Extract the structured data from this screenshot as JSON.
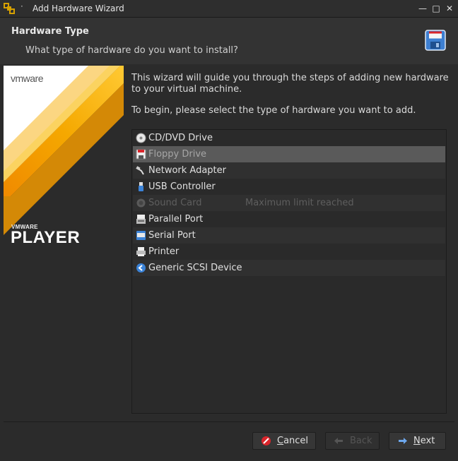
{
  "window": {
    "title": "Add Hardware Wizard",
    "menu_glyph": "·",
    "controls": {
      "minimize": "—",
      "maximize": "□",
      "close": "✕"
    }
  },
  "header": {
    "title": "Hardware Type",
    "subtitle": "What type of hardware do you want to install?",
    "icon": "floppy-disk-icon"
  },
  "banner": {
    "logo": "vmware",
    "product_small": "VMWARE",
    "product_big": "PLAYER"
  },
  "intro": {
    "line1": "This wizard will guide you through the steps of adding new hardware to your virtual machine.",
    "line2": "To begin, please select the type of hardware you want to add."
  },
  "hardware_list": [
    {
      "label": "CD/DVD Drive",
      "note": "",
      "icon": "cd-dvd-icon",
      "state": "normal"
    },
    {
      "label": "Floppy Drive",
      "note": "",
      "icon": "floppy-icon",
      "state": "selected"
    },
    {
      "label": "Network Adapter",
      "note": "",
      "icon": "network-adapter-icon",
      "state": "normal"
    },
    {
      "label": "USB Controller",
      "note": "",
      "icon": "usb-icon",
      "state": "normal"
    },
    {
      "label": "Sound Card",
      "note": "Maximum limit reached",
      "icon": "sound-card-icon",
      "state": "disabled"
    },
    {
      "label": "Parallel Port",
      "note": "",
      "icon": "parallel-port-icon",
      "state": "normal"
    },
    {
      "label": "Serial Port",
      "note": "",
      "icon": "serial-port-icon",
      "state": "normal"
    },
    {
      "label": "Printer",
      "note": "",
      "icon": "printer-icon",
      "state": "normal"
    },
    {
      "label": "Generic SCSI Device",
      "note": "",
      "icon": "scsi-icon",
      "state": "normal"
    }
  ],
  "buttons": {
    "cancel": {
      "mnemonic": "C",
      "rest": "ancel",
      "enabled": true
    },
    "back": {
      "label": "Back",
      "enabled": false
    },
    "next": {
      "mnemonic": "N",
      "rest": "ext",
      "enabled": true
    }
  },
  "colors": {
    "accent_orange": "#f5a800",
    "cancel_red": "#d9252b",
    "next_blue": "#3b83d8"
  }
}
